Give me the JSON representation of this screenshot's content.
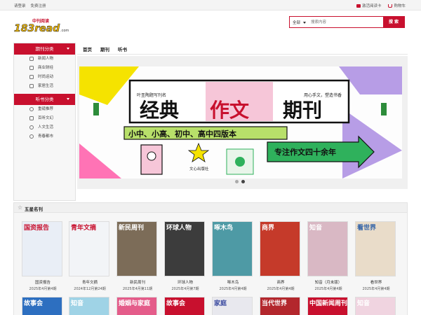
{
  "topbar": {
    "login": "请登录",
    "register": "免费注册",
    "reader_card": "激活阅读卡",
    "cart": "购物车"
  },
  "logo": {
    "text": "183read",
    "sub": "中刊阅读",
    "tld": ".com"
  },
  "search": {
    "category": "全部",
    "placeholder": "搜索内容",
    "button": "搜 索"
  },
  "sidebar": {
    "periodical_head": "期刊分类",
    "periodical_items": [
      "新闻人物",
      "商业财经",
      "时尚运动",
      "家居生活"
    ],
    "audio_head": "听书分类",
    "audio_items": [
      "重磅推荐",
      "百听文幻",
      "人文生活",
      "青春都市"
    ]
  },
  "nav": [
    "首页",
    "期刊",
    "听书"
  ],
  "banner": {
    "top_left": "叶圣陶题写刊名",
    "top_right": "用心手文，塑造书香",
    "title_parts": [
      "经典",
      "作文",
      "期刊"
    ],
    "subtitle": "小中、小高、初中、高中四版本",
    "slogan": "专注作文四十余年",
    "publisher": "文心出版社"
  },
  "carousel": {
    "count": 2,
    "active": 1
  },
  "section": {
    "title": "五星名刊"
  },
  "magazines": [
    {
      "name": "国资报告",
      "date": "2025年4月第4期",
      "cover_title": "国资报告",
      "color": "#e9eef6",
      "title_color": "#c8102e"
    },
    {
      "name": "青年文摘",
      "date": "2024年12月第24期",
      "cover_title": "青年文摘",
      "color": "#f2f4f7",
      "title_color": "#c8102e"
    },
    {
      "name": "新民周刊",
      "date": "2025年4月第11期",
      "cover_title": "新民周刊",
      "color": "#7c6c58",
      "title_color": "#ffffff"
    },
    {
      "name": "环球人物",
      "date": "2025年4月第7期",
      "cover_title": "环球人物",
      "color": "#3c3c3c",
      "title_color": "#ffffff"
    },
    {
      "name": "啄木鸟",
      "date": "2025年4月第4期",
      "cover_title": "啄木鸟",
      "color": "#4e9aa5",
      "title_color": "#ffffff"
    },
    {
      "name": "商界",
      "date": "2025年4月第4期",
      "cover_title": "商界",
      "color": "#c53a2a",
      "title_color": "#ffffff"
    },
    {
      "name": "知音（月末版）",
      "date": "2025年4月第4期",
      "cover_title": "知音",
      "color": "#d9b8c4",
      "title_color": "#ffffff"
    },
    {
      "name": "看世界",
      "date": "2025年4月第4期",
      "cover_title": "看世界",
      "color": "#e9dcc9",
      "title_color": "#2b5ea6"
    }
  ],
  "magazines_row2": [
    {
      "cover_title": "故事会",
      "color": "#2d6fc0",
      "title_color": "#ffffff"
    },
    {
      "cover_title": "知音",
      "color": "#9fd3e6",
      "title_color": "#ffffff"
    },
    {
      "cover_title": "婚姻与家庭",
      "color": "#e45c8a",
      "title_color": "#ffffff"
    },
    {
      "cover_title": "故事会",
      "color": "#c8102e",
      "title_color": "#ffffff"
    },
    {
      "cover_title": "家庭",
      "color": "#e8e8ee",
      "title_color": "#3a4aa0"
    },
    {
      "cover_title": "当代世界",
      "color": "#b3272d",
      "title_color": "#ffffff"
    },
    {
      "cover_title": "中国新闻周刊",
      "color": "#c8102e",
      "title_color": "#ffffff"
    },
    {
      "cover_title": "知音",
      "color": "#f0d4e0",
      "title_color": "#ffffff"
    }
  ],
  "colors": {
    "brand_red": "#c8102e"
  }
}
